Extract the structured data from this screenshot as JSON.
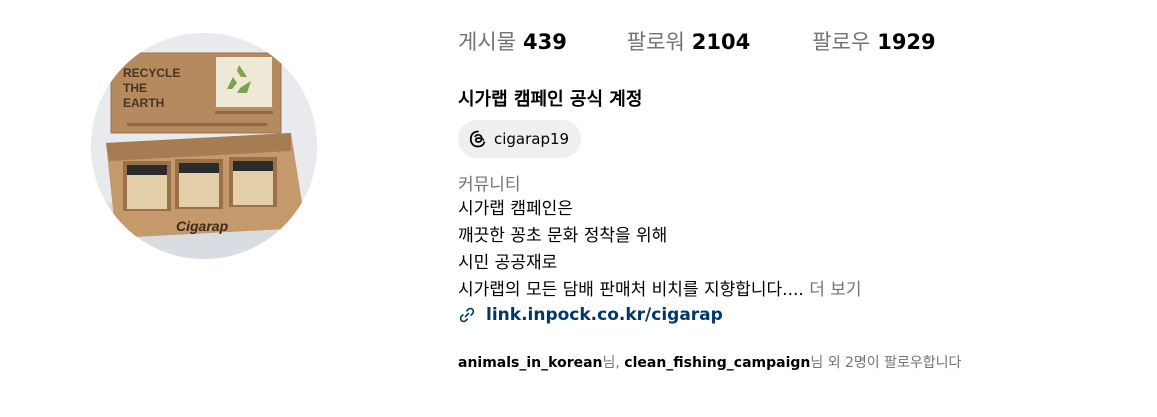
{
  "profile": {
    "avatar_alt": "profile-photo",
    "stats": [
      {
        "label": "게시물",
        "value": "439"
      },
      {
        "label": "팔로워",
        "value": "2104"
      },
      {
        "label": "팔로우",
        "value": "1929"
      }
    ],
    "display_name": "시가랩 캠페인 공식 계정",
    "threads_handle": "cigarap19",
    "category": "커뮤니티",
    "bio_lines": [
      "시가랩 캠페인은",
      "깨끗한 꽁초 문화 정착을 위해",
      "시민 공공재로",
      "시가랩의 모든 담배 판매처 비치를 지향합니다...."
    ],
    "more_label": " 더 보기",
    "link": "link.inpock.co.kr/cigarap",
    "followed_by": {
      "user1": "animals_in_korean",
      "sep1": "님, ",
      "user2": "clean_fishing_campaign",
      "rest": "님 외 2명이 팔로우합니다"
    }
  },
  "photo_text": {
    "box_title_1": "RECYCLE",
    "box_title_2": "THE",
    "box_title_3": "EARTH",
    "brand": "Cigarap"
  },
  "colors": {
    "link": "#00376b",
    "muted": "#737373",
    "badge_bg": "#efefef"
  }
}
